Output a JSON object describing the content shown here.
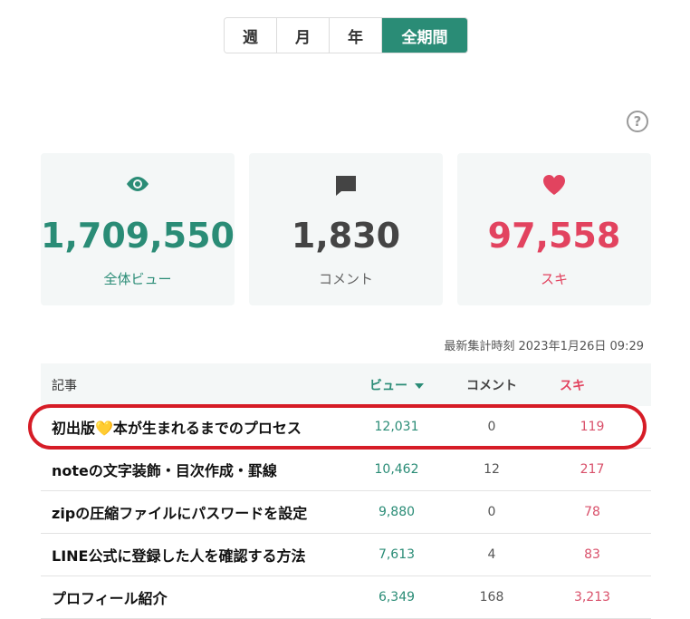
{
  "period_tabs": [
    {
      "label": "週",
      "active": false
    },
    {
      "label": "月",
      "active": false
    },
    {
      "label": "年",
      "active": false
    },
    {
      "label": "全期間",
      "active": true
    }
  ],
  "help": {
    "label": "?"
  },
  "summary": {
    "views": {
      "value": "1,709,550",
      "label": "全体ビュー",
      "icon": "eye-icon",
      "color": "#2a8c76"
    },
    "comments": {
      "value": "1,830",
      "label": "コメント",
      "icon": "comment-icon",
      "color": "#444444"
    },
    "likes": {
      "value": "97,558",
      "label": "スキ",
      "icon": "heart-icon",
      "color": "#e2435f"
    }
  },
  "last_updated": "最新集計時刻 2023年1月26日 09:29",
  "table": {
    "headers": {
      "title": "記事",
      "views": "ビュー",
      "comments": "コメント",
      "likes": "スキ"
    },
    "rows": [
      {
        "title": "初出版💛本が生まれるまでのプロセス",
        "views": "12,031",
        "comments": "0",
        "likes": "119"
      },
      {
        "title": "noteの文字装飾・目次作成・罫線",
        "views": "10,462",
        "comments": "12",
        "likes": "217"
      },
      {
        "title": "zipの圧縮ファイルにパスワードを設定",
        "views": "9,880",
        "comments": "0",
        "likes": "78"
      },
      {
        "title": "LINE公式に登録した人を確認する方法",
        "views": "7,613",
        "comments": "4",
        "likes": "83"
      },
      {
        "title": "プロフィール紹介",
        "views": "6,349",
        "comments": "168",
        "likes": "3,213"
      }
    ]
  }
}
